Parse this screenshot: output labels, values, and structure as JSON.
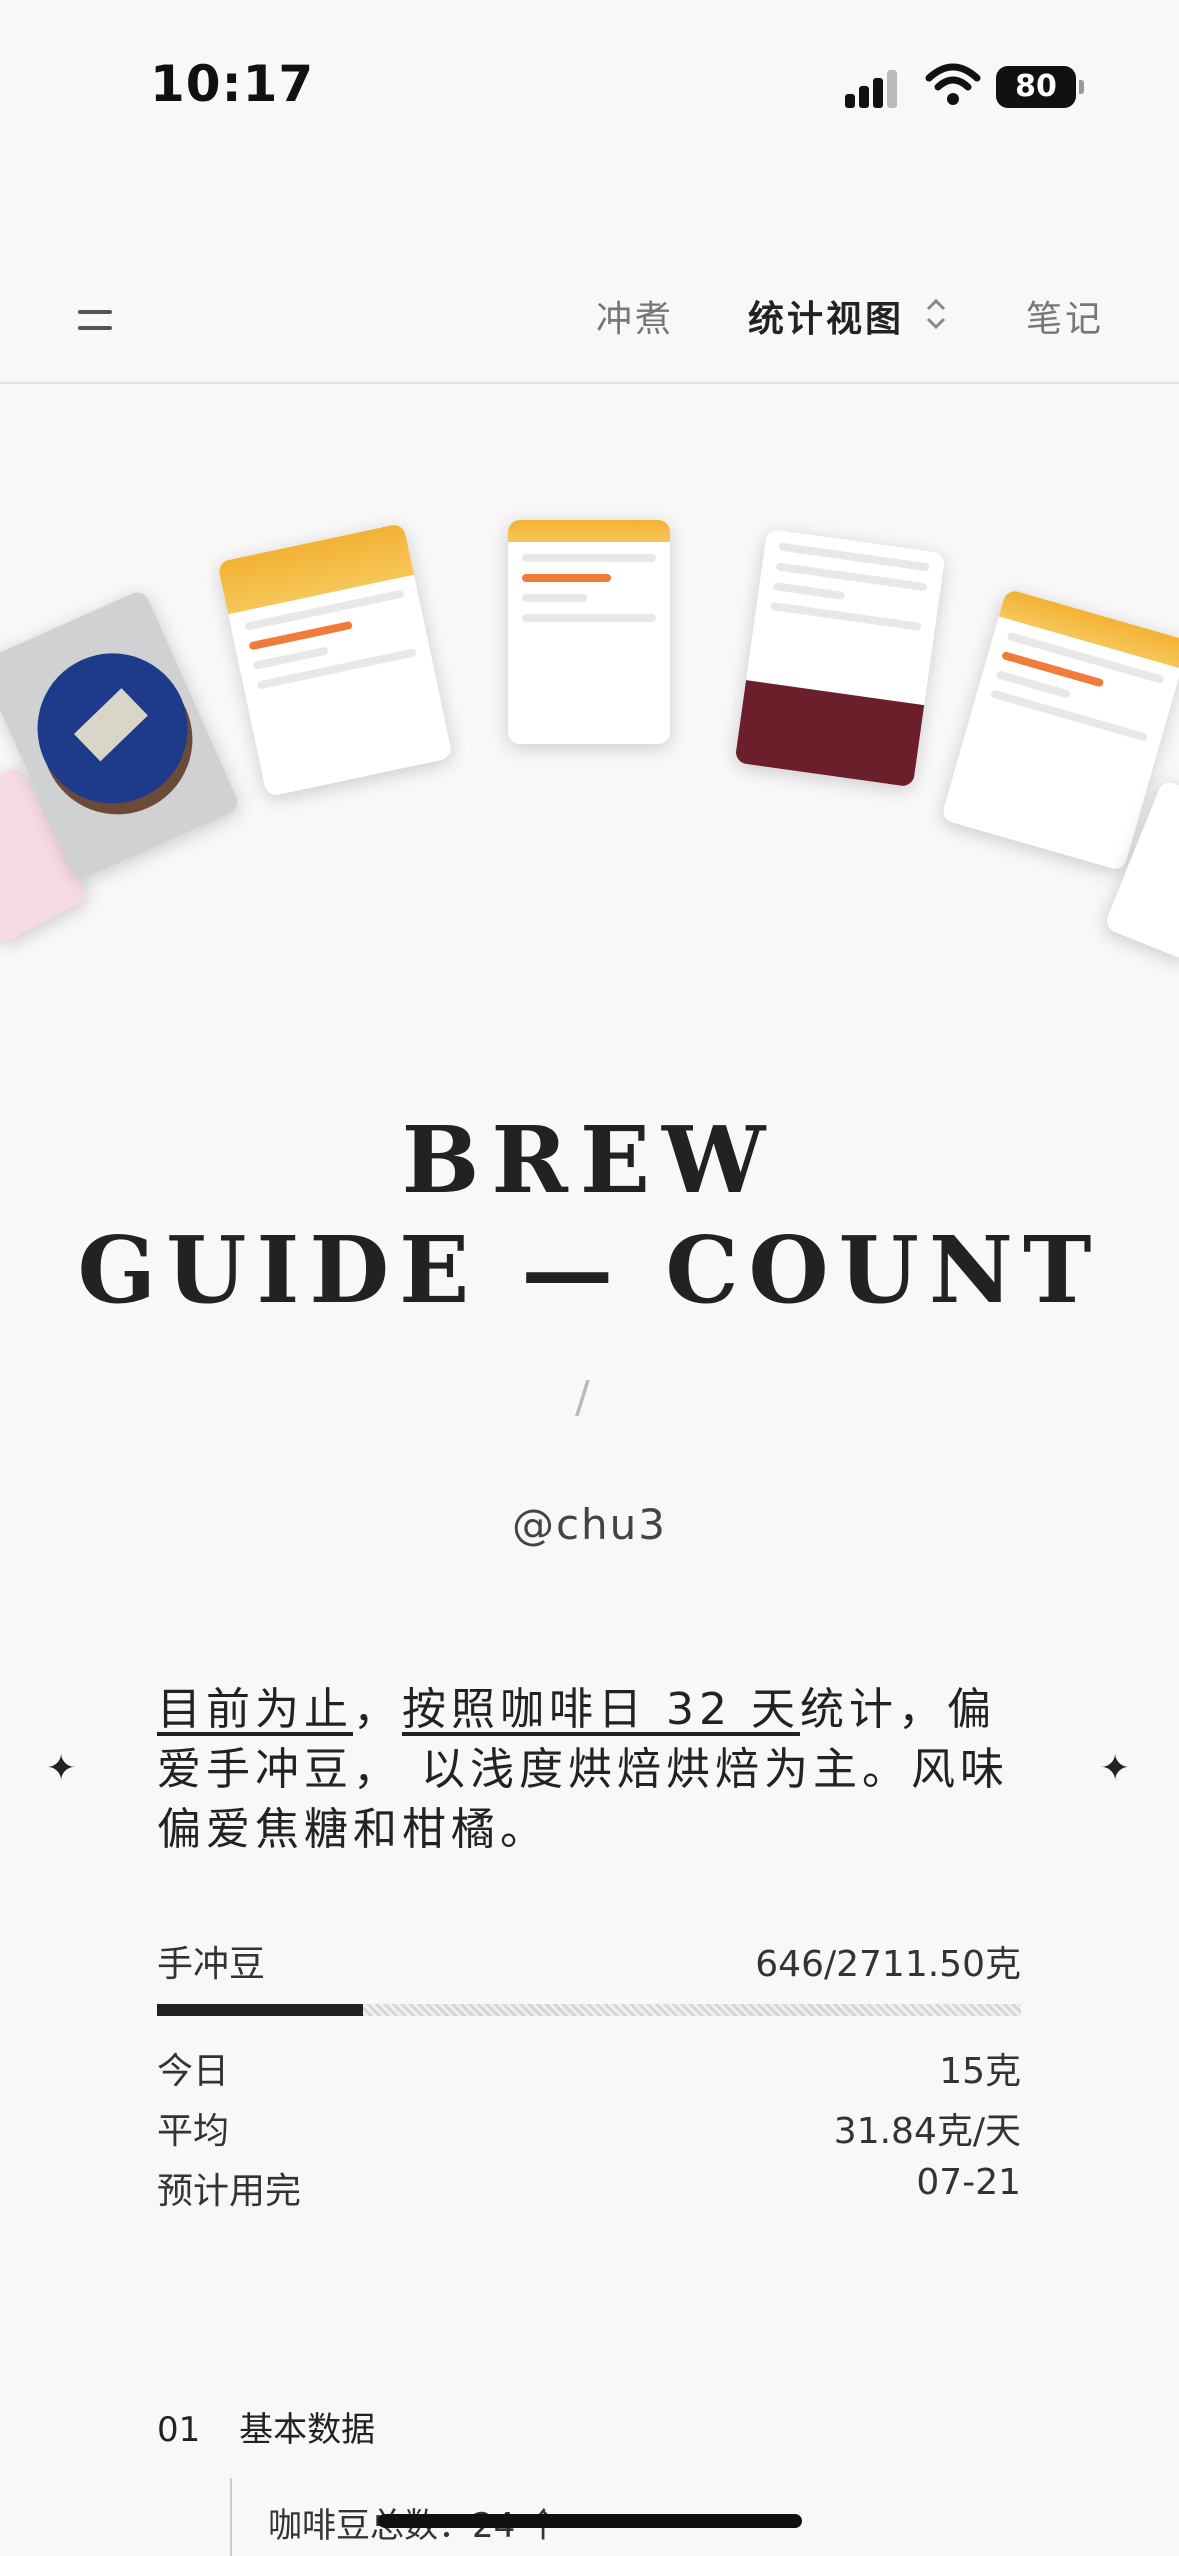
{
  "status_bar": {
    "time": "10:17",
    "battery": "80"
  },
  "nav": {
    "tabs": [
      {
        "label": "冲煮"
      },
      {
        "label": "统计视图"
      },
      {
        "label": "笔记"
      }
    ],
    "active_tab": "统计视图"
  },
  "hero": {
    "title_line1": "BREW",
    "title_line2": "GUIDE — COUNT",
    "separator": "/",
    "handle": "@chu3"
  },
  "summary": {
    "part1": "目前为止",
    "part2": "，",
    "part3": "按照咖啡日 32 天",
    "part4": "统计，偏爱手冲豆， 以浅度烘焙烘焙为主。风味偏爱焦糖和柑橘。"
  },
  "usage": {
    "label": "手冲豆",
    "value": "646/2711.50克",
    "progress": 0.238,
    "today_label": "今日",
    "today_value": "15克",
    "avg_label": "平均",
    "avg_value": "31.84克/天",
    "eta_label": "预计用完",
    "eta_value": "07-21"
  },
  "section": {
    "number": "01",
    "title": "基本数据",
    "first_item": "咖啡豆总数：24 个"
  },
  "colors": {
    "accent_yellow": "#f3b233",
    "accent_orange": "#f07b3a",
    "text": "#222222"
  }
}
